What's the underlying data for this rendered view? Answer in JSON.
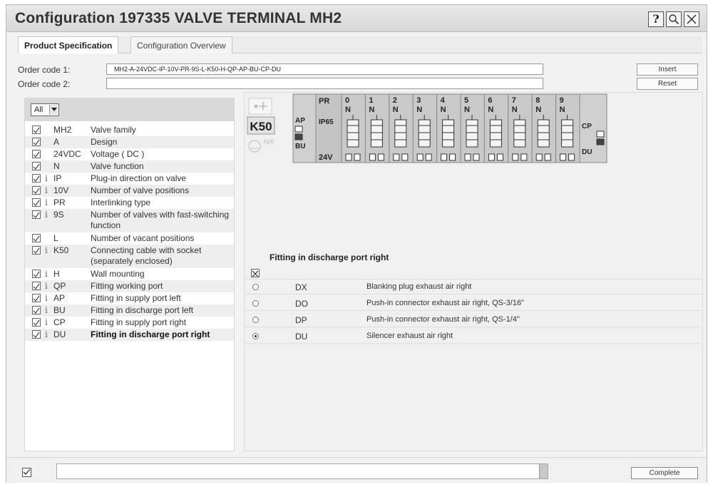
{
  "window": {
    "title": "Configuration 197335 VALVE TERMINAL MH2",
    "buttons": [
      {
        "name": "help-icon",
        "label": "?"
      },
      {
        "name": "zoom-icon",
        "label": ""
      },
      {
        "name": "close-icon",
        "label": ""
      }
    ]
  },
  "tabs": [
    {
      "label": "Product Specification",
      "active": true
    },
    {
      "label": "Configuration Overview",
      "active": false
    }
  ],
  "order": {
    "code1_label": "Order code 1:",
    "code1_value": "MH2-A-24VDC-IP-10V-PR-9S-L-K50-H-QP-AP-BU-CP-DU",
    "code2_label": "Order code 2:",
    "code2_value": "",
    "insert_label": "Insert",
    "reset_label": "Reset"
  },
  "filter": {
    "value": "All"
  },
  "features": [
    {
      "code": "MH2",
      "desc": "Valve family",
      "info": false
    },
    {
      "code": "A",
      "desc": "Design",
      "info": false
    },
    {
      "code": "24VDC",
      "desc": "Voltage ( DC )",
      "info": false
    },
    {
      "code": "N",
      "desc": "Valve function",
      "info": false
    },
    {
      "code": "IP",
      "desc": "Plug-in direction on valve",
      "info": true
    },
    {
      "code": "10V",
      "desc": "Number of valve positions",
      "info": true
    },
    {
      "code": "PR",
      "desc": "Interlinking type",
      "info": true
    },
    {
      "code": "9S",
      "desc": "Number of valves with fast-switching function",
      "info": true
    },
    {
      "code": "L",
      "desc": "Number of vacant positions",
      "info": false
    },
    {
      "code": "K50",
      "desc": "Connecting cable with socket (separately enclosed)",
      "info": true
    },
    {
      "code": "H",
      "desc": "Wall mounting",
      "info": true
    },
    {
      "code": "QP",
      "desc": "Fitting working port",
      "info": true
    },
    {
      "code": "AP",
      "desc": "Fitting in supply port left",
      "info": true
    },
    {
      "code": "BU",
      "desc": "Fitting in discharge port left",
      "info": true
    },
    {
      "code": "CP",
      "desc": "Fitting in supply port right",
      "info": true
    },
    {
      "code": "DU",
      "desc": "Fitting in discharge port right",
      "info": true
    }
  ],
  "diagram": {
    "cable_label": "K50",
    "nk_label": "N/K",
    "pr_label": "PR",
    "ip_label": "IP65",
    "voltage_label": "24V",
    "left_top": "AP",
    "left_bottom": "BU",
    "right_top": "CP",
    "right_bottom": "DU",
    "positions": [
      "0",
      "1",
      "2",
      "3",
      "4",
      "5",
      "6",
      "7",
      "8",
      "9"
    ],
    "valve_letter": "N"
  },
  "options": {
    "title": "Fitting in discharge port right",
    "rows": [
      {
        "code": "DX",
        "desc": "Blanking plug exhaust air right",
        "selected": false
      },
      {
        "code": "DO",
        "desc": "Push-in connector exhaust air right, QS-3/16\"",
        "selected": false
      },
      {
        "code": "DP",
        "desc": "Push-in connector exhaust air right, QS-1/4\"",
        "selected": false
      },
      {
        "code": "DU",
        "desc": "Silencer exhaust air right",
        "selected": true
      }
    ]
  },
  "footer": {
    "status_text": "",
    "complete_label": "Complete"
  }
}
